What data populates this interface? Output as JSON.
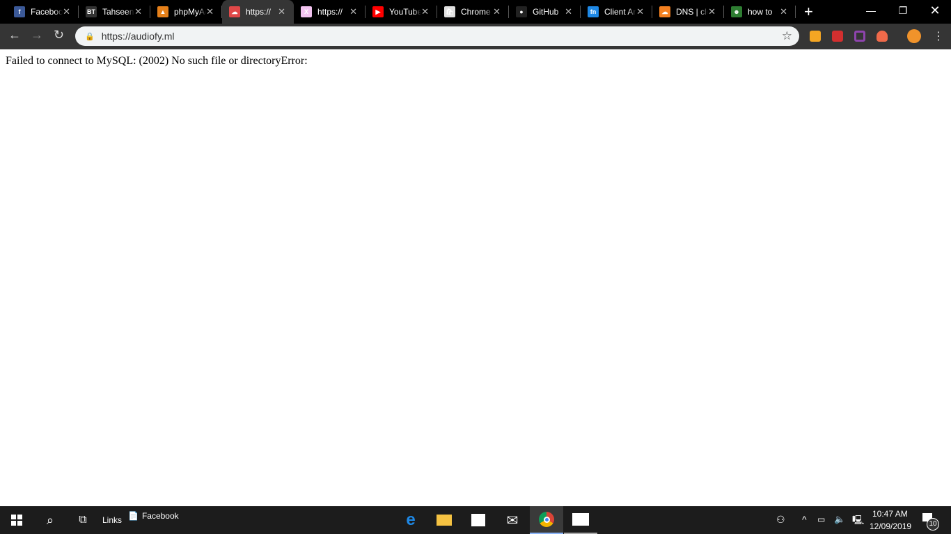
{
  "browser": {
    "tabs": [
      {
        "title": "Facebook",
        "icon": "facebook-icon",
        "color": "#3b5998",
        "glyph": "f"
      },
      {
        "title": "Tahseen",
        "icon": "bt-icon",
        "color": "#333",
        "glyph": "BT"
      },
      {
        "title": "phpMyAdmin",
        "icon": "phpmyadmin-icon",
        "color": "#e5801a",
        "glyph": "▲"
      },
      {
        "title": "https://",
        "icon": "cloud-icon",
        "color": "#e04848",
        "glyph": "☁",
        "active": true
      },
      {
        "title": "https://",
        "icon": "x-logo-icon",
        "color": "#f2c3f0",
        "glyph": "X"
      },
      {
        "title": "YouTube",
        "icon": "youtube-icon",
        "color": "#ff0000",
        "glyph": "▶"
      },
      {
        "title": "Chrome",
        "icon": "chrome-store-icon",
        "color": "#e0e0e0",
        "glyph": "🛍"
      },
      {
        "title": "GitHub",
        "icon": "github-icon",
        "color": "#222",
        "glyph": "●"
      },
      {
        "title": "Client Area",
        "icon": "client-icon",
        "color": "#1e88e5",
        "glyph": "fn"
      },
      {
        "title": "DNS | cloudflare",
        "icon": "cloudflare-icon",
        "color": "#f38020",
        "glyph": "☁"
      },
      {
        "title": "how to",
        "icon": "android-icon",
        "color": "#2e7d32",
        "glyph": "☻"
      }
    ],
    "url": "https://audiofy.ml"
  },
  "page": {
    "message": "Failed to connect to MySQL: (2002) No such file or directoryError:"
  },
  "taskbar": {
    "links_label": "Links",
    "facebook_label": "Facebook",
    "time": "10:47 AM",
    "date": "12/09/2019",
    "notifications": "10"
  }
}
